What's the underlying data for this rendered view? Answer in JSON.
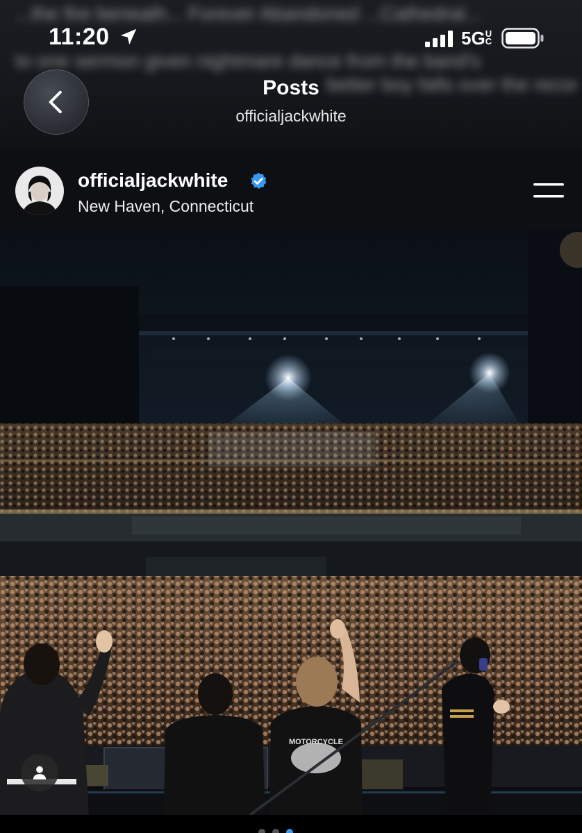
{
  "status_bar": {
    "time": "11:20",
    "network": "5G",
    "network_suffix": "UC",
    "location_icon": "location-arrow-icon",
    "signal_icon": "cellular-signal-icon",
    "battery_icon": "battery-icon"
  },
  "background_caption": {
    "line1": "...the fire beneath... Forever Abandoned ...Cathedral...",
    "line2": "to one sermon given nightmare dance from the band's",
    "line3": "better boy falls over the recording studio... more"
  },
  "header": {
    "title": "Posts",
    "subtitle": "officialjackwhite",
    "back_icon": "chevron-left-icon"
  },
  "post": {
    "username": "officialjackwhite",
    "verified": true,
    "verified_icon": "verified-badge-icon",
    "location": "New Haven, Connecticut",
    "menu_icon": "menu-icon",
    "tag_icon": "user-tag-icon",
    "photo_description_alt": "",
    "shirt_text": "MOTORCYCLE",
    "carousel_count": 3,
    "carousel_active_index": 2
  },
  "colors": {
    "background": "#000000",
    "header_bg": "#15181c",
    "verified_blue": "#3897f0",
    "text_primary": "#ffffff"
  }
}
